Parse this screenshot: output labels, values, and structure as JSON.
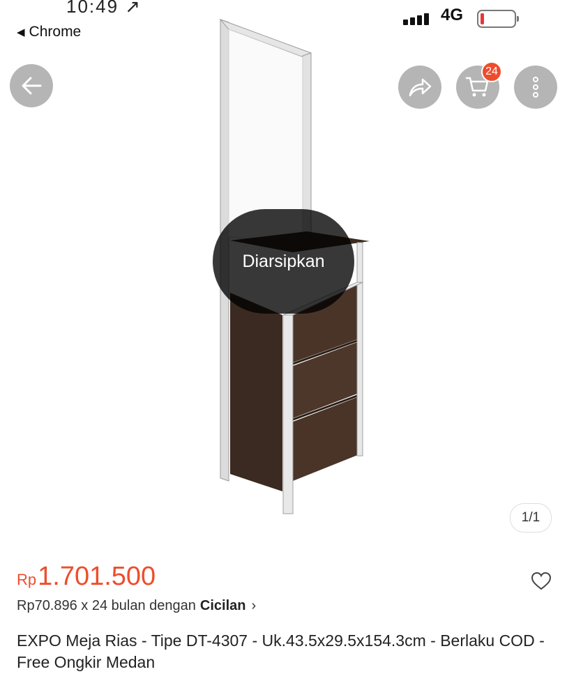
{
  "status_bar": {
    "time_partial": "10:49 ↗",
    "back_app_label": "Chrome",
    "network": "4G"
  },
  "toolbar": {
    "cart_count": "24"
  },
  "product": {
    "archived_toast": "Diarsipkan",
    "image_counter": "1/1",
    "price_currency": "Rp",
    "price_value": "1.701.500",
    "installment_text": "Rp70.896 x 24 bulan dengan",
    "installment_link": "Cicilan",
    "title": "EXPO Meja Rias - Tipe DT-4307 - Uk.43.5x29.5x154.3cm - Berlaku COD - Free Ongkir Medan"
  },
  "colors": {
    "accent": "#ee4d2d",
    "battery_low": "#e53935"
  },
  "icons": [
    "back-arrow-icon",
    "share-icon",
    "cart-icon",
    "more-icon",
    "heart-icon",
    "chevron-right-icon"
  ]
}
